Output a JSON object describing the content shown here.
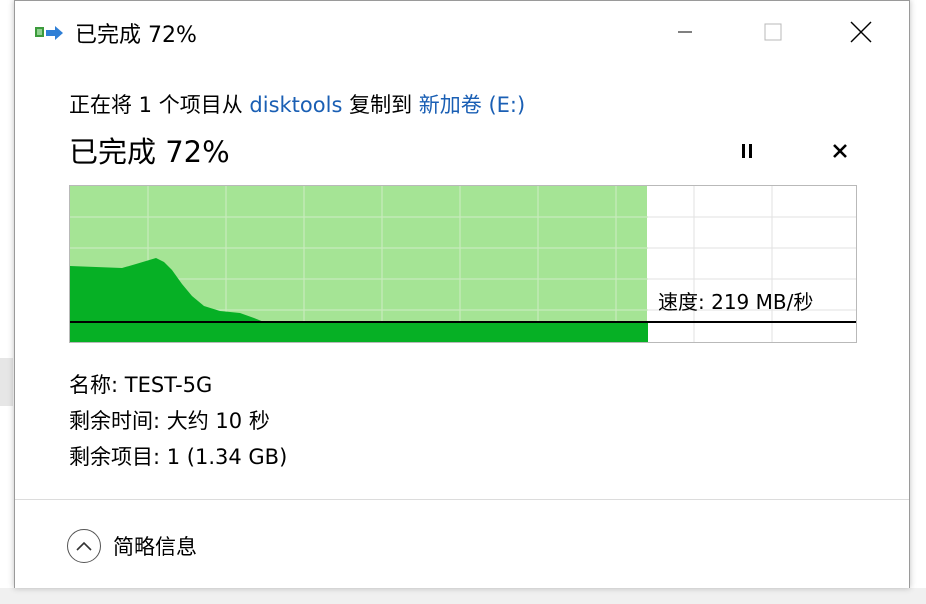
{
  "window": {
    "title": "已完成 72%"
  },
  "copy_line": {
    "prefix": "正在将 1 个项目从",
    "source": "disktools",
    "middle": "复制到",
    "destination": "新加卷 (E:)"
  },
  "progress": {
    "heading": "已完成 72%",
    "percent": 72
  },
  "graph": {
    "speed_label": "速度: 219 MB/秒"
  },
  "details": {
    "name": "名称: TEST-5G",
    "time_remaining": "剩余时间: 大约 10 秒",
    "items_remaining": "剩余项目: 1 (1.34 GB)"
  },
  "footer": {
    "less_details_label": "简略信息"
  },
  "colors": {
    "progress_fill": "#a5e495",
    "speed_fill": "#06b025",
    "link": "#1a5fb4",
    "grid": "#c8e6c0"
  },
  "icons": {
    "title": "copy-arrow-icon",
    "pause": "pause-icon",
    "cancel": "close-icon",
    "collapse": "chevron-up-icon"
  }
}
